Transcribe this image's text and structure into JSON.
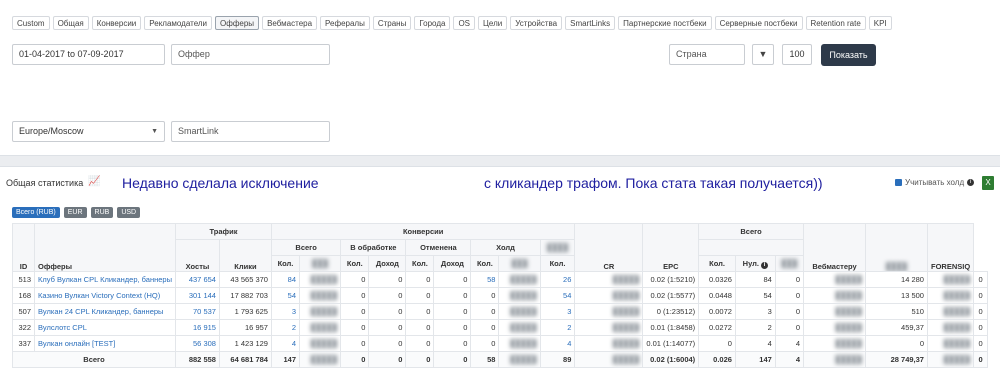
{
  "tabs": [
    "Custom",
    "Общая",
    "Конверсии",
    "Рекламодатели",
    "Офферы",
    "Вебмастера",
    "Рефералы",
    "Страны",
    "Города",
    "OS",
    "Цели",
    "Устройства",
    "SmartLinks",
    "Партнерские постбеки",
    "Серверные постбеки",
    "Retention rate",
    "KPI"
  ],
  "active_tab": "Офферы",
  "filters": {
    "date_range": "01-04-2017 to 07-09-2017",
    "offer_placeholder": "Оффер",
    "country_placeholder": "Страна",
    "limit": "100",
    "show_label": "Показать",
    "timezone": "Europe/Moscow",
    "smartlink_placeholder": "SmartLink"
  },
  "stats": {
    "title": "Общая статистика",
    "annotation_left": "Недавно сделала исключение",
    "annotation_right": "с кликандер трафом. Пока стата такая получается))",
    "hold_label": "Учитывать холд",
    "currencies": [
      "Всего (RUB)",
      "EUR",
      "RUB",
      "USD"
    ]
  },
  "table": {
    "group_headers": {
      "traffic": "Трафик",
      "conversions": "Конверсии",
      "total": "Всего",
      "processing": "В обработке",
      "canceled": "Отменена",
      "hold": "Холд",
      "all": "Всего"
    },
    "col_headers": {
      "id": "ID",
      "offers": "Офферы",
      "hosts": "Хосты",
      "clicks": "Клики",
      "qty": "Кол.",
      "income": "Доход",
      "cr": "CR",
      "epc": "EPC",
      "zero": "Нул.",
      "webmaster": "Вебмастеру",
      "forensiq": "FORENSIQ"
    },
    "rows": [
      {
        "id": "513",
        "offer": "Клуб Вулкан CPL Кликандер, баннеры",
        "hosts": "437 654",
        "clicks": "43 565 370",
        "total_qty": "84",
        "proc_qty": "0",
        "proc_inc": "0",
        "canc_qty": "0",
        "canc_inc": "0",
        "hold_qty": "58",
        "app_qty": "26",
        "cr": "0.02 (1:5210)",
        "epc": "0.0326",
        "all_qty": "84",
        "all_zero": "0",
        "webmaster": "14 280",
        "forensiq": "0"
      },
      {
        "id": "168",
        "offer": "Казино Вулкан Victory Context (HQ)",
        "hosts": "301 144",
        "clicks": "17 882 703",
        "total_qty": "54",
        "proc_qty": "0",
        "proc_inc": "0",
        "canc_qty": "0",
        "canc_inc": "0",
        "hold_qty": "0",
        "app_qty": "54",
        "cr": "0.02 (1:5577)",
        "epc": "0.0448",
        "all_qty": "54",
        "all_zero": "0",
        "webmaster": "13 500",
        "forensiq": "0"
      },
      {
        "id": "507",
        "offer": "Вулкан 24 CPL Кликандер, баннеры",
        "hosts": "70 537",
        "clicks": "1 793 625",
        "total_qty": "3",
        "proc_qty": "0",
        "proc_inc": "0",
        "canc_qty": "0",
        "canc_inc": "0",
        "hold_qty": "0",
        "app_qty": "3",
        "cr": "0 (1:23512)",
        "epc": "0.0072",
        "all_qty": "3",
        "all_zero": "0",
        "webmaster": "510",
        "forensiq": "0"
      },
      {
        "id": "322",
        "offer": "Вулслотс CPL",
        "hosts": "16 915",
        "clicks": "16 957",
        "total_qty": "2",
        "proc_qty": "0",
        "proc_inc": "0",
        "canc_qty": "0",
        "canc_inc": "0",
        "hold_qty": "0",
        "app_qty": "2",
        "cr": "0.01 (1:8458)",
        "epc": "0.0272",
        "all_qty": "2",
        "all_zero": "0",
        "webmaster": "459,37",
        "forensiq": "0"
      },
      {
        "id": "337",
        "offer": "Вулкан онлайн [TEST]",
        "hosts": "56 308",
        "clicks": "1 423 129",
        "total_qty": "4",
        "proc_qty": "0",
        "proc_inc": "0",
        "canc_qty": "0",
        "canc_inc": "0",
        "hold_qty": "0",
        "app_qty": "4",
        "cr": "0.01 (1:14077)",
        "epc": "0",
        "all_qty": "4",
        "all_zero": "4",
        "webmaster": "0",
        "forensiq": "0"
      }
    ],
    "totals": {
      "label": "Всего",
      "hosts": "882 558",
      "clicks": "64 681 784",
      "total_qty": "147",
      "proc_qty": "0",
      "proc_inc": "0",
      "canc_qty": "0",
      "canc_inc": "0",
      "hold_qty": "58",
      "app_qty": "89",
      "cr": "0.02 (1:6004)",
      "epc": "0.026",
      "all_qty": "147",
      "all_zero": "4",
      "webmaster": "28 749,37",
      "forensiq": "0"
    }
  }
}
